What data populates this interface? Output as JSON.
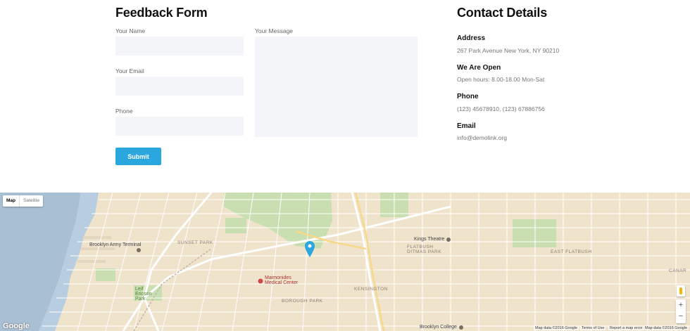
{
  "feedback": {
    "title": "Feedback Form",
    "name_label": "Your Name",
    "email_label": "Your Email",
    "phone_label": "Phone",
    "message_label": "Your Message",
    "submit_label": "Submit"
  },
  "contact": {
    "title": "Contact Details",
    "address_title": "Address",
    "address_value": "267 Park Avenue New York, NY 90210",
    "open_title": "We Are Open",
    "open_value": "Open hours: 8.00-18.00 Mon-Sat",
    "phone_title": "Phone",
    "phone_value": "(123) 45678910, (123) 67886756",
    "email_title": "Email",
    "email_value": "info@demolink.org"
  },
  "map": {
    "toggle_map": "Map",
    "toggle_satellite": "Satellite",
    "zoom_in": "+",
    "zoom_out": "−",
    "logo": "Google",
    "labels": {
      "army_terminal": "Brooklyn Army Terminal",
      "sunset_park": "SUNSET PARK",
      "leif_ericson": "Leif Ericson Park",
      "maimonides": "Maimonides Medical Center",
      "kensington": "KENSINGTON",
      "borough_park": "BOROUGH PARK",
      "kings_theatre": "Kings Theatre",
      "flatbush": "FLATBUSH DITMAS PARK",
      "east_flatbush": "EAST FLATBUSH",
      "canarsie": "CANAR",
      "brooklyn_college": "Brooklyn College"
    },
    "attribution": {
      "data": "Map data ©2016 Google",
      "terms": "Terms of Use",
      "report": "Report a map error",
      "data2": "Map data ©2016 Google"
    },
    "colors": {
      "land": "#efe3cc",
      "water": "#a9bfd4",
      "park": "#c9dfb1",
      "road": "#ffffff",
      "marker": "#2aa7df"
    }
  }
}
